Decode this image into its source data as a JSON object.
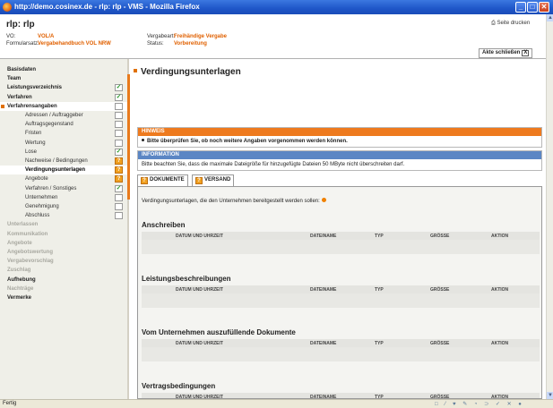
{
  "window": {
    "title": "http://demo.cosinex.de - rlp: rlp - VMS - Mozilla Firefox",
    "min": "_",
    "max": "□",
    "close": "✕"
  },
  "header": {
    "title": "rlp: rlp",
    "print_label": "Seite drucken",
    "vo_label": "VO:",
    "vo_value": "VOL/A",
    "formularsatz_label": "Formularsatz:",
    "formularsatz_value": "Vergabehandbuch VOL NRW",
    "vergabeart_label": "Vergabeart:",
    "vergabeart_value": "Freihändige Vergabe",
    "status_label": "Status:",
    "status_value": "Vorbereitung",
    "close_akte_label": "Akte schließen",
    "close_akte_x": "X"
  },
  "sidebar": {
    "items": [
      {
        "label": "Basisdaten",
        "kind": "main",
        "check": ""
      },
      {
        "label": "Team",
        "kind": "main",
        "check": ""
      },
      {
        "label": "Leistungsverzeichnis",
        "kind": "main",
        "check": "ok"
      },
      {
        "label": "Verfahren",
        "kind": "main",
        "check": "ok"
      },
      {
        "label": "Verfahrensangaben",
        "kind": "main",
        "check": "empty",
        "bullet": true
      },
      {
        "label": "Adressen / Auftraggeber",
        "kind": "sub",
        "check": "empty"
      },
      {
        "label": "Auftragsgegenstand",
        "kind": "sub",
        "check": "empty"
      },
      {
        "label": "Fristen",
        "kind": "sub",
        "check": "empty"
      },
      {
        "label": "Wertung",
        "kind": "sub",
        "check": "empty"
      },
      {
        "label": "Lose",
        "kind": "sub",
        "check": "ok"
      },
      {
        "label": "Nachweise / Bedingungen",
        "kind": "sub",
        "check": "warn"
      },
      {
        "label": "Verdingungsunterlagen",
        "kind": "sub",
        "check": "warn",
        "active": true
      },
      {
        "label": "Angebote",
        "kind": "sub",
        "check": "warn"
      },
      {
        "label": "Verfahren / Sonstiges",
        "kind": "sub",
        "check": "ok"
      },
      {
        "label": "Unternehmen",
        "kind": "sub",
        "check": "empty"
      },
      {
        "label": "Genehmigung",
        "kind": "sub",
        "check": "empty"
      },
      {
        "label": "Abschluss",
        "kind": "sub",
        "check": "empty"
      },
      {
        "label": "Unterlassen",
        "kind": "dis",
        "check": ""
      },
      {
        "label": "Kommunikation",
        "kind": "dis",
        "check": ""
      },
      {
        "label": "Angebote",
        "kind": "dis",
        "check": ""
      },
      {
        "label": "Angebotswertung",
        "kind": "dis",
        "check": ""
      },
      {
        "label": "Vergabevorschlag",
        "kind": "dis",
        "check": ""
      },
      {
        "label": "Zuschlag",
        "kind": "dis",
        "check": ""
      },
      {
        "label": "Aufhebung",
        "kind": "main",
        "check": ""
      },
      {
        "label": "Nachträge",
        "kind": "dis",
        "check": ""
      },
      {
        "label": "Vermerke",
        "kind": "main",
        "check": ""
      }
    ],
    "check_ok_glyph": "✓",
    "check_warn_glyph": "?"
  },
  "main": {
    "title": "Verdingungsunterlagen",
    "hinweis_title": "HINWEIS",
    "hinweis_text": "Bitte überprüfen Sie, ob noch weitere Angaben vorgenommen werden können.",
    "info_title": "INFORMATION",
    "info_text": "Bitte beachten Sie, dass die maximale Dateigröße für hinzugefügte Dateien 50 MByte nicht überschreiten darf.",
    "tabs": [
      {
        "label": "DOKUMENTE"
      },
      {
        "label": "VERSAND"
      }
    ],
    "tab_icon_glyph": "?",
    "intro": "Verdingungsunterlagen, die den Unternehmen bereitgestellt werden sollen:",
    "columns": [
      "DATUM UND UHRZEIT",
      "DATEINAME",
      "TYP",
      "GRÖSSE",
      "AKTION"
    ],
    "sections": [
      {
        "title": "Anschreiben"
      },
      {
        "title": "Leistungsbeschreibungen"
      },
      {
        "title": "Vom Unternehmen auszufüllende Dokumente"
      },
      {
        "title": "Vertragsbedingungen"
      }
    ]
  },
  "statusbar": {
    "text": "Fertig",
    "icons": "□ ⁄ ♥ ✎ ◔ ⊃ ✓ ✕ ●"
  },
  "scrollbar": {
    "up": "▲",
    "down": "▼"
  }
}
